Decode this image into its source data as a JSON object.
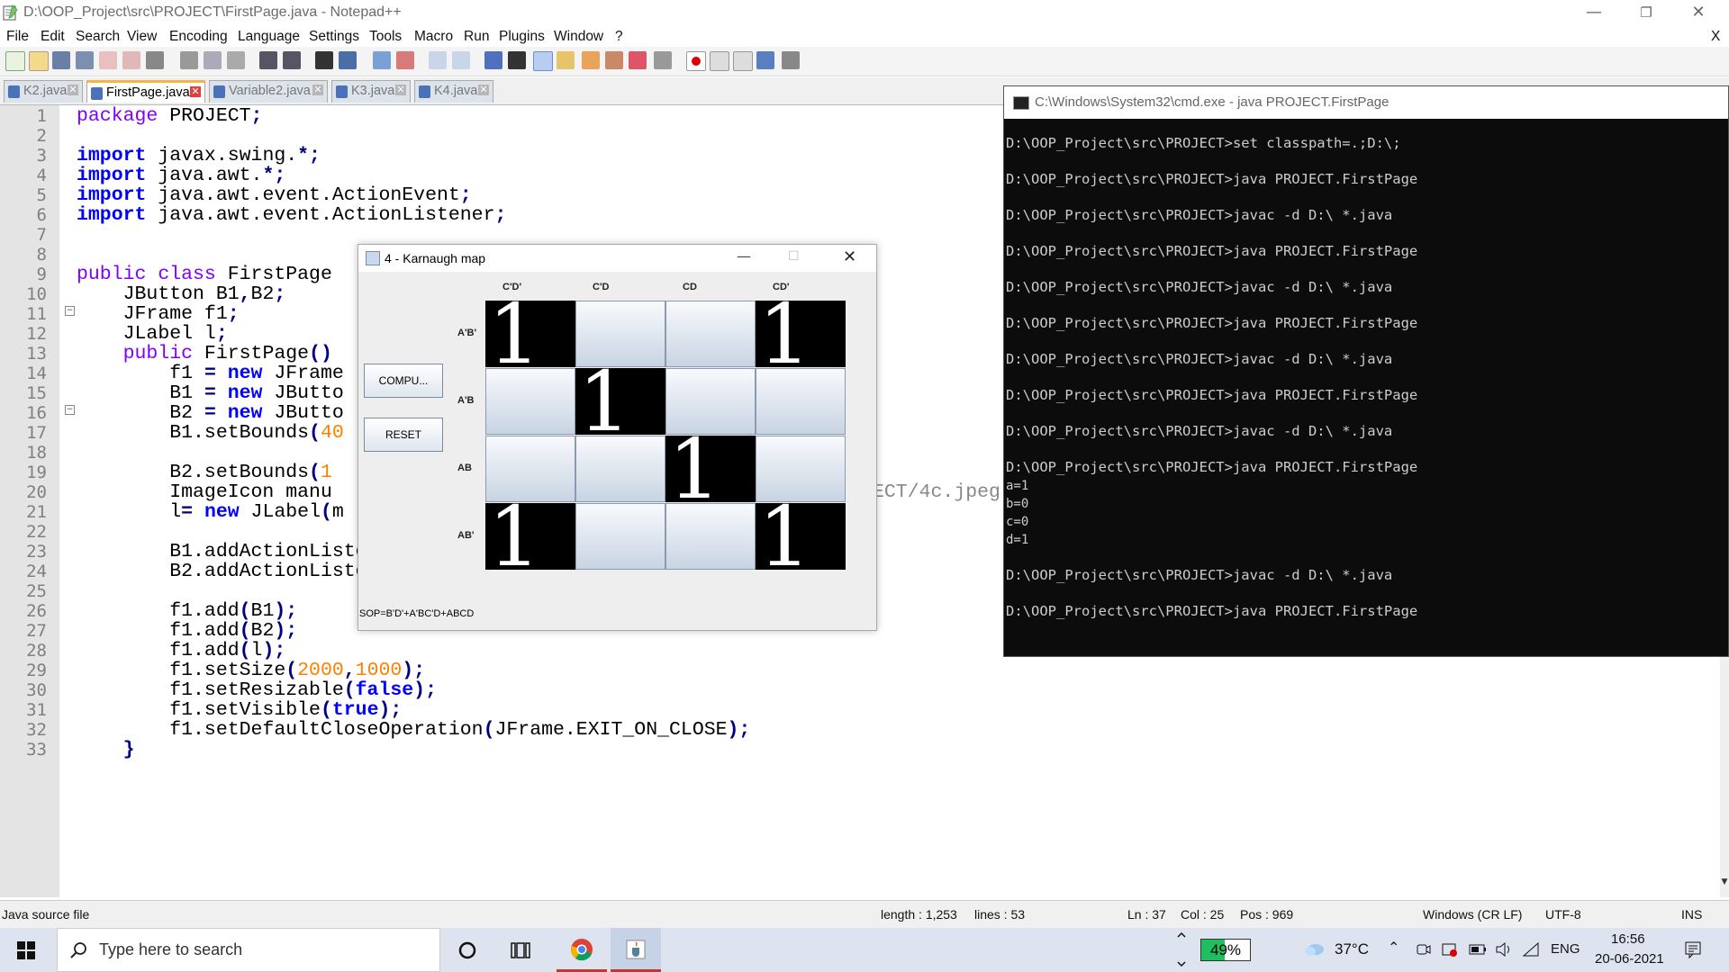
{
  "window": {
    "title": "D:\\OOP_Project\\src\\PROJECT\\FirstPage.java - Notepad++",
    "close_doc": "X"
  },
  "menu": [
    "File",
    "Edit",
    "Search",
    "View",
    "Encoding",
    "Language",
    "Settings",
    "Tools",
    "Macro",
    "Run",
    "Plugins",
    "Window",
    "?"
  ],
  "tabs": [
    {
      "label": "K2.java",
      "active": false
    },
    {
      "label": "FirstPage.java",
      "active": true
    },
    {
      "label": "Variable2.java",
      "active": false
    },
    {
      "label": "K3.java",
      "active": false
    },
    {
      "label": "K4.java",
      "active": false
    }
  ],
  "editor": {
    "line_numbers": [
      "1",
      "2",
      "3",
      "4",
      "5",
      "6",
      "7",
      "8",
      "9",
      "10",
      "11",
      "12",
      "13",
      "14",
      "15",
      "16",
      "17",
      "18",
      "19",
      "20",
      "21",
      "22",
      "23",
      "24",
      "25",
      "26",
      "27",
      "28",
      "29",
      "30",
      "31",
      "32",
      "33"
    ],
    "overflow_text": "ECT/4c.jpeg"
  },
  "cmd": {
    "title": "C:\\Windows\\System32\\cmd.exe - java  PROJECT.FirstPage",
    "lines": [
      "D:\\OOP_Project\\src\\PROJECT>set classpath=.;D:\\;",
      "D:\\OOP_Project\\src\\PROJECT>java PROJECT.FirstPage",
      "D:\\OOP_Project\\src\\PROJECT>javac -d D:\\ *.java",
      "D:\\OOP_Project\\src\\PROJECT>java PROJECT.FirstPage",
      "D:\\OOP_Project\\src\\PROJECT>javac -d D:\\ *.java",
      "D:\\OOP_Project\\src\\PROJECT>java PROJECT.FirstPage",
      "D:\\OOP_Project\\src\\PROJECT>javac -d D:\\ *.java",
      "D:\\OOP_Project\\src\\PROJECT>java PROJECT.FirstPage",
      "D:\\OOP_Project\\src\\PROJECT>javac -d D:\\ *.java",
      "D:\\OOP_Project\\src\\PROJECT>java PROJECT.FirstPage",
      "a=1",
      "b=0",
      "c=0",
      "d=1",
      "D:\\OOP_Project\\src\\PROJECT>javac -d D:\\ *.java",
      "D:\\OOP_Project\\src\\PROJECT>java PROJECT.FirstPage"
    ]
  },
  "kmap": {
    "title": "4 - Karnaugh map",
    "compute_label": "COMPU...",
    "reset_label": "RESET",
    "col_headers": [
      "C'D'",
      "C'D",
      "CD",
      "CD'"
    ],
    "row_headers": [
      "A'B'",
      "A'B",
      "AB",
      "AB'"
    ],
    "cells": [
      [
        "1",
        "",
        "",
        "1"
      ],
      [
        "",
        "1",
        "",
        ""
      ],
      [
        "",
        "",
        "1",
        ""
      ],
      [
        "1",
        "",
        "",
        "1"
      ]
    ],
    "result": "SOP=B'D'+A'BC'D+ABCD"
  },
  "status": {
    "file_type": "Java source file",
    "length": "length : 1,253",
    "lines": "lines : 53",
    "ln": "Ln : 37",
    "col": "Col : 25",
    "pos": "Pos : 969",
    "eol": "Windows (CR LF)",
    "encoding": "UTF-8",
    "mode": "INS"
  },
  "taskbar": {
    "search_placeholder": "Type here to search",
    "battery": "49%",
    "temperature": "37°C",
    "language": "ENG",
    "time": "16:56",
    "date": "20-06-2021"
  }
}
